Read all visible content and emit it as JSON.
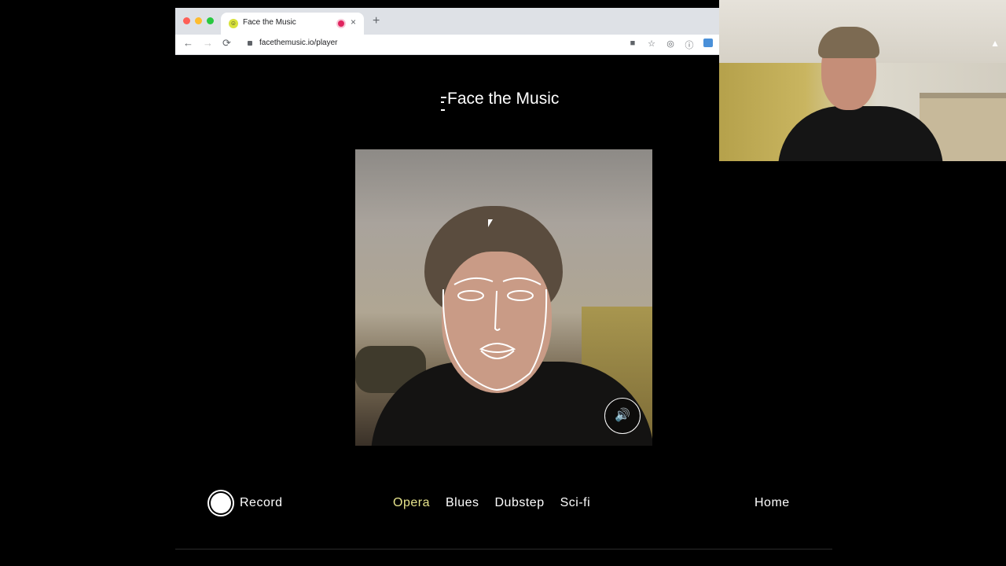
{
  "browser": {
    "tab_title": "Face the Music",
    "tab_close": "×",
    "new_tab": "+",
    "url": "facethemusic.io/player",
    "back": "←",
    "forward": "→",
    "reload": "⟳"
  },
  "app": {
    "logo_text": "Face the Music",
    "record_label": "Record",
    "genres": [
      "Opera",
      "Blues",
      "Dubstep",
      "Sci-fi"
    ],
    "active_genre": "Opera",
    "home_label": "Home"
  },
  "colors": {
    "background": "#000000",
    "active_genre": "#e7e48c",
    "text": "#ffffff"
  },
  "icons": [
    "favicon-icon",
    "recording-indicator-icon",
    "close-icon",
    "plus-icon",
    "back-icon",
    "forward-icon",
    "reload-icon",
    "lock-icon",
    "camera-icon",
    "star-icon",
    "sound-icon",
    "record-icon"
  ]
}
